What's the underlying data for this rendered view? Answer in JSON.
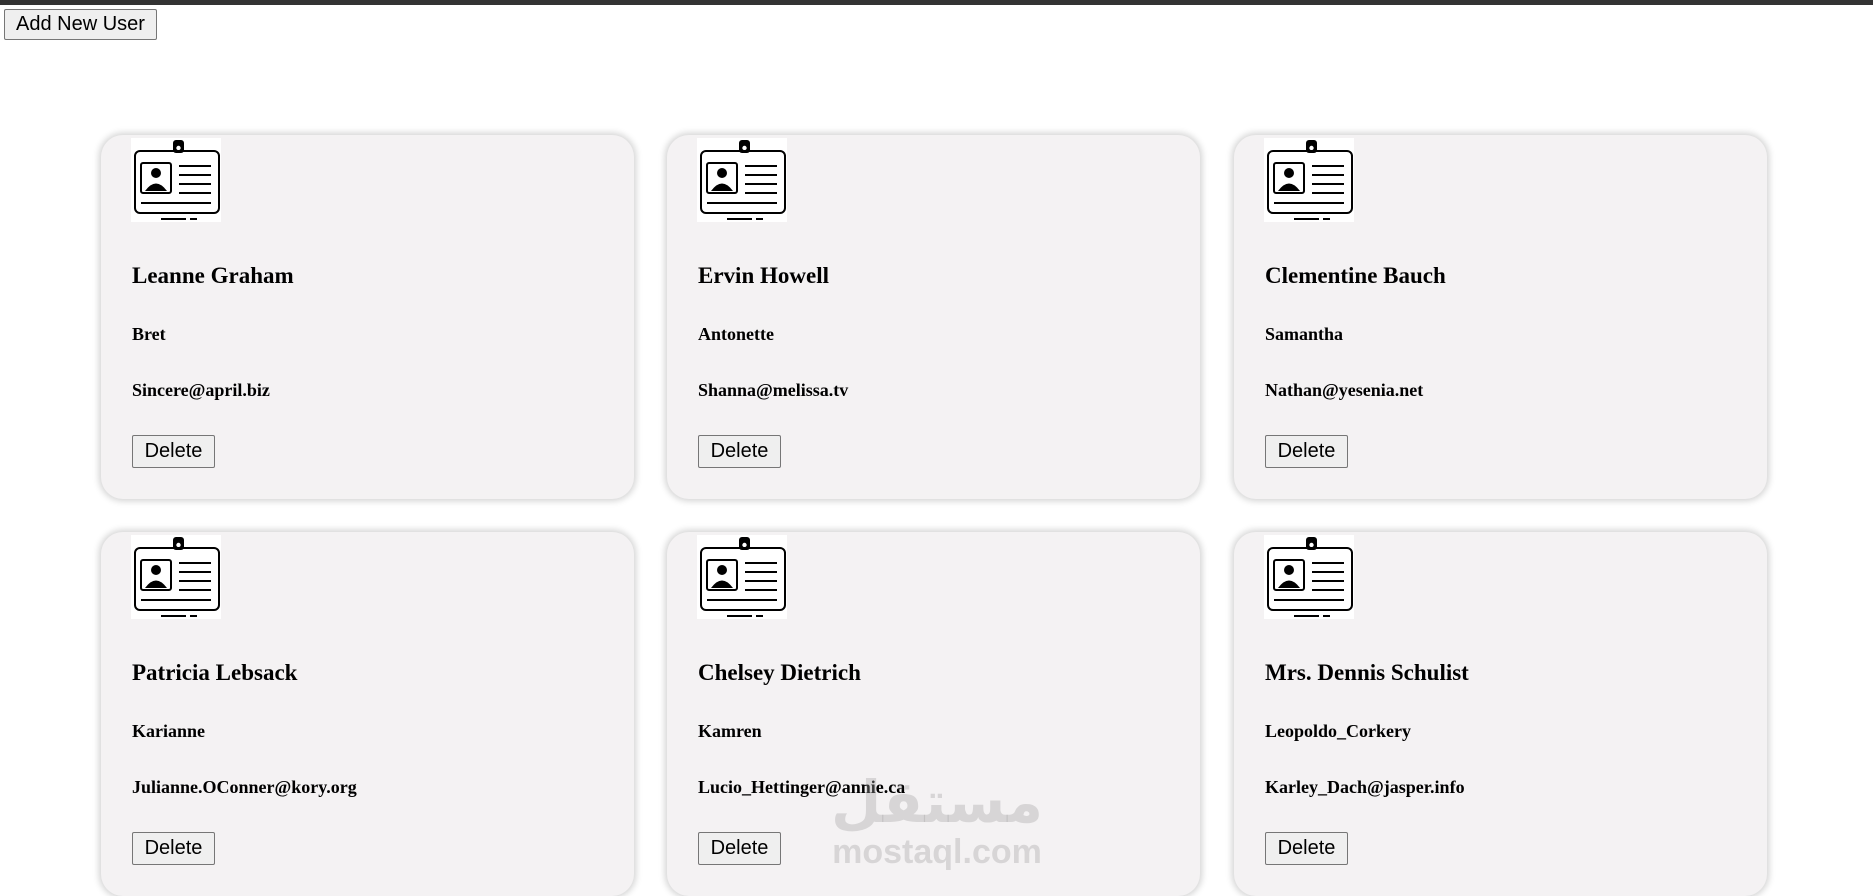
{
  "toolbar": {
    "add_label": "Add New User"
  },
  "users": [
    {
      "name": "Leanne Graham",
      "username": "Bret",
      "email": "Sincere@april.biz",
      "delete_label": "Delete"
    },
    {
      "name": "Ervin Howell",
      "username": "Antonette",
      "email": "Shanna@melissa.tv",
      "delete_label": "Delete"
    },
    {
      "name": "Clementine Bauch",
      "username": "Samantha",
      "email": "Nathan@yesenia.net",
      "delete_label": "Delete"
    },
    {
      "name": "Patricia Lebsack",
      "username": "Karianne",
      "email": "Julianne.OConner@kory.org",
      "delete_label": "Delete"
    },
    {
      "name": "Chelsey Dietrich",
      "username": "Kamren",
      "email": "Lucio_Hettinger@annie.ca",
      "delete_label": "Delete"
    },
    {
      "name": "Mrs. Dennis Schulist",
      "username": "Leopoldo_Corkery",
      "email": "Karley_Dach@jasper.info",
      "delete_label": "Delete"
    }
  ],
  "watermark": {
    "arabic": "مستقل",
    "latin": "mostaql.com"
  },
  "icons": {
    "card_icon": "id-badge-icon"
  },
  "colors": {
    "card_background": "#f4f2f3",
    "top_bar": "#333333"
  }
}
